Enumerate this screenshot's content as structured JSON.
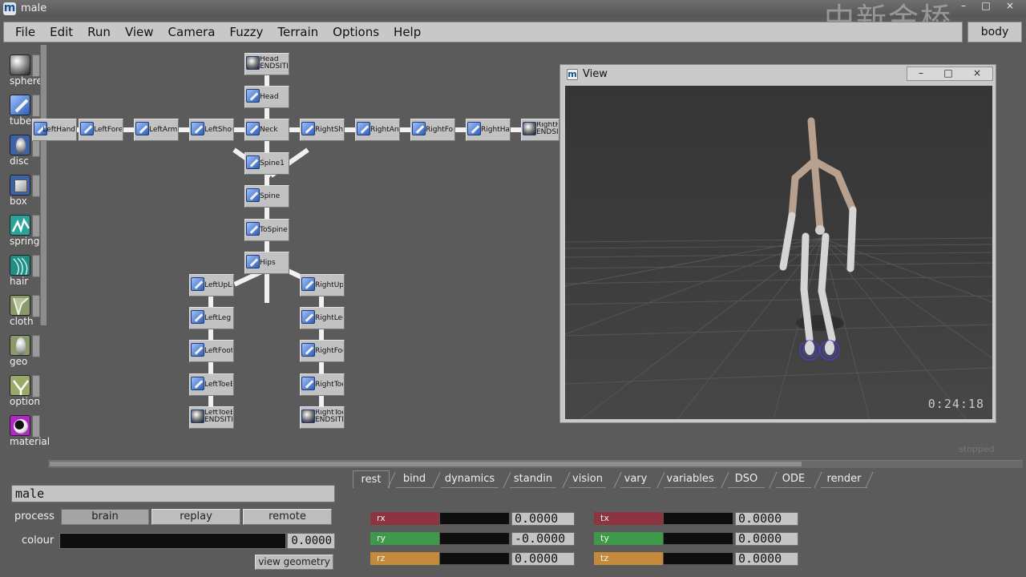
{
  "window": {
    "title": "male",
    "logo": "m",
    "watermark": "中新金桥",
    "buttons": {
      "minimize": "–",
      "maximize": "□",
      "close": "×"
    }
  },
  "menu": {
    "items": [
      "File",
      "Edit",
      "Run",
      "View",
      "Camera",
      "Fuzzy",
      "Terrain",
      "Options",
      "Help"
    ]
  },
  "body_button": "body",
  "palette": {
    "items": [
      {
        "label": "sphere",
        "icon": "sphere-icon"
      },
      {
        "label": "tube",
        "icon": "tube-icon"
      },
      {
        "label": "disc",
        "icon": "disc-icon"
      },
      {
        "label": "box",
        "icon": "box-icon"
      },
      {
        "label": "spring",
        "icon": "spring-icon"
      },
      {
        "label": "hair",
        "icon": "hair-icon"
      },
      {
        "label": "cloth",
        "icon": "cloth-icon"
      },
      {
        "label": "geo",
        "icon": "geo-icon"
      },
      {
        "label": "option",
        "icon": "option-icon"
      },
      {
        "label": "material",
        "icon": "material-icon"
      }
    ]
  },
  "graph": {
    "nodes": [
      {
        "id": "head-end",
        "label": "Head ENDSITE",
        "kind": "end"
      },
      {
        "id": "head",
        "label": "Head",
        "kind": "bone"
      },
      {
        "id": "left-hand",
        "label": "LeftHand",
        "kind": "bone"
      },
      {
        "id": "left-fore-arm",
        "label": "LeftForeArm",
        "kind": "bone"
      },
      {
        "id": "left-arm",
        "label": "LeftArm",
        "kind": "bone"
      },
      {
        "id": "left-shoulder",
        "label": "LeftShoulder",
        "kind": "bone"
      },
      {
        "id": "neck",
        "label": "Neck",
        "kind": "bone"
      },
      {
        "id": "right-shoulder",
        "label": "RightShoulder",
        "kind": "bone"
      },
      {
        "id": "right-arm",
        "label": "RightArm",
        "kind": "bone"
      },
      {
        "id": "right-fore-arm",
        "label": "RightForeArm",
        "kind": "bone"
      },
      {
        "id": "right-hand",
        "label": "RightHand",
        "kind": "bone"
      },
      {
        "id": "right-hand-end",
        "label": "RightHand ENDSITE",
        "kind": "end"
      },
      {
        "id": "spine1",
        "label": "Spine1",
        "kind": "bone"
      },
      {
        "id": "spine",
        "label": "Spine",
        "kind": "bone"
      },
      {
        "id": "to-spine",
        "label": "ToSpine",
        "kind": "bone"
      },
      {
        "id": "hips",
        "label": "Hips",
        "kind": "bone"
      },
      {
        "id": "left-up-leg",
        "label": "LeftUpLeg",
        "kind": "bone"
      },
      {
        "id": "right-up-leg",
        "label": "RightUpLeg",
        "kind": "bone"
      },
      {
        "id": "left-leg",
        "label": "LeftLeg",
        "kind": "bone"
      },
      {
        "id": "right-leg",
        "label": "RightLeg",
        "kind": "bone"
      },
      {
        "id": "left-foot",
        "label": "LeftFoot",
        "kind": "bone"
      },
      {
        "id": "right-foot",
        "label": "RightFoot",
        "kind": "bone"
      },
      {
        "id": "left-toe-base",
        "label": "LeftToeBase",
        "kind": "bone"
      },
      {
        "id": "right-toe-base",
        "label": "RightToeBase",
        "kind": "bone"
      },
      {
        "id": "left-toe-base-end",
        "label": "LeftToeBase ENDSITE",
        "kind": "end"
      },
      {
        "id": "right-toe-base-end",
        "label": "RightToeBase ENDSITE",
        "kind": "end"
      }
    ]
  },
  "view": {
    "title": "View",
    "timecode": "0:24:18",
    "status": "stopped"
  },
  "panel": {
    "name": "male",
    "process_label": "process",
    "process_buttons": [
      {
        "label": "brain",
        "active": true
      },
      {
        "label": "replay",
        "active": false
      },
      {
        "label": "remote",
        "active": false
      }
    ],
    "colour_label": "colour",
    "colour_value": "0.0000",
    "view_geometry": "view geometry"
  },
  "tabs": [
    "rest",
    "bind",
    "dynamics",
    "standin",
    "vision",
    "vary",
    "variables",
    "DSO",
    "ODE",
    "render"
  ],
  "active_tab": "rest",
  "transform": {
    "rows": [
      {
        "label": "rx",
        "value": "0.0000",
        "color": "#8e3440"
      },
      {
        "label": "ry",
        "value": "-0.0000",
        "color": "#3e9a4a"
      },
      {
        "label": "rz",
        "value": "0.0000",
        "color": "#c48a3a"
      },
      {
        "label": "tx",
        "value": "0.0000",
        "color": "#8e3440"
      },
      {
        "label": "ty",
        "value": "0.0000",
        "color": "#3e9a4a"
      },
      {
        "label": "tz",
        "value": "0.0000",
        "color": "#c48a3a"
      }
    ]
  }
}
